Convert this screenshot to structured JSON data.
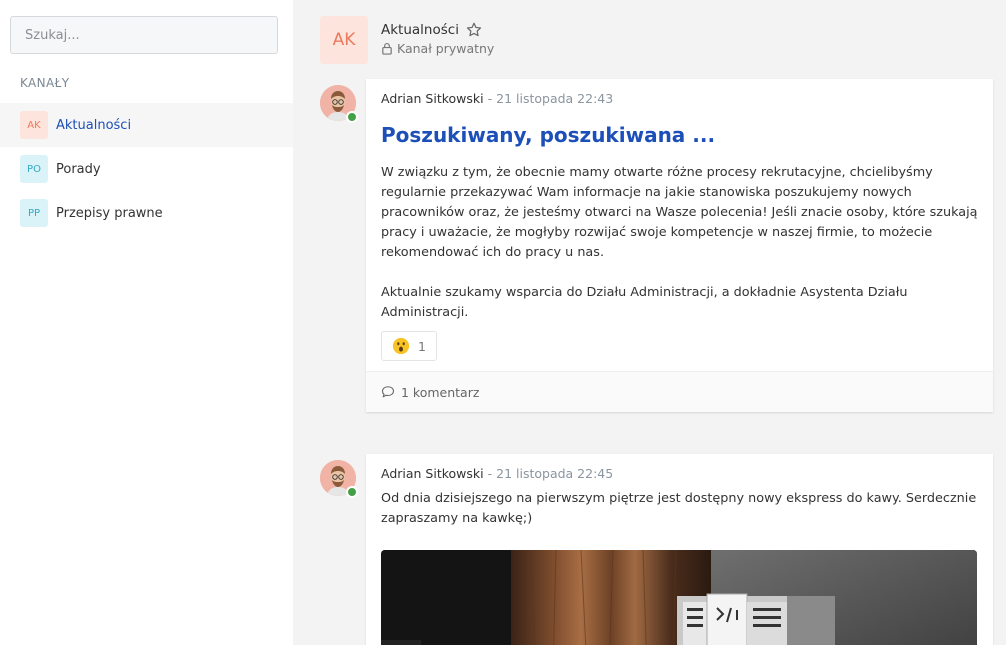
{
  "sidebar": {
    "search_placeholder": "Szukaj...",
    "section_label": "KANAŁY",
    "channels": [
      {
        "badge": "AK",
        "name": "Aktualności",
        "active": true
      },
      {
        "badge": "PO",
        "name": "Porady",
        "active": false
      },
      {
        "badge": "PP",
        "name": "Przepisy prawne",
        "active": false
      }
    ]
  },
  "header": {
    "badge": "AK",
    "title": "Aktualności",
    "subtitle": "Kanał prywatny"
  },
  "posts": [
    {
      "author": "Adrian Sitkowski",
      "separator": "-",
      "time": "21 listopada 22:43",
      "title": "Poszukiwany, poszukiwana ...",
      "paragraph1": "W związku z tym, że obecnie mamy otwarte różne procesy rekrutacyjne, chcielibyśmy regularnie przekazywać Wam informacje na jakie stanowiska poszukujemy nowych pracowników oraz, że jesteśmy otwarci na Wasze polecenia! Jeśli znacie osoby, które szukają pracy i uważacie, że mogłyby rozwijać swoje kompetencje w naszej firmie, to możecie rekomendować ich do pracy u nas.",
      "paragraph2": "Aktualnie szukamy wsparcia do Działu Administracji, a dokładnie Asystenta Działu Administracji.",
      "reaction_count": "1",
      "comments": "1 komentarz"
    },
    {
      "author": "Adrian Sitkowski",
      "separator": "-",
      "time": "21 listopada 22:45",
      "body": "Od dnia dzisiejszego na pierwszym piętrze jest dostępny nowy ekspress do kawy. Serdecznie zapraszamy na kawkę;)"
    }
  ],
  "colors": {
    "accent": "#1c4fb8",
    "online": "#43a047",
    "badge_ak": "#fde4dc",
    "badge_po": "#d9f3f8"
  }
}
